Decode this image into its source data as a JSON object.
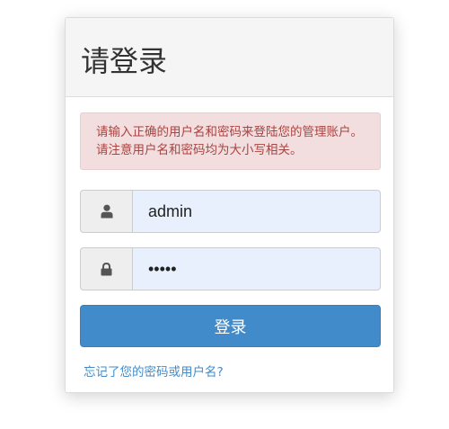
{
  "panel": {
    "title": "请登录"
  },
  "alert": {
    "message": "请输入正确的用户名和密码来登陆您的管理账户。请注意用户名和密码均为大小写相关。"
  },
  "form": {
    "username_value": "admin",
    "password_value": "12345",
    "user_icon": "user-icon",
    "lock_icon": "lock-icon",
    "login_label": "登录",
    "forgot_label": "忘记了您的密码或用户名?"
  },
  "colors": {
    "primary": "#428bca",
    "alert_bg": "#f2dede",
    "alert_text": "#a94442",
    "autofill_bg": "#e8f0fe"
  }
}
